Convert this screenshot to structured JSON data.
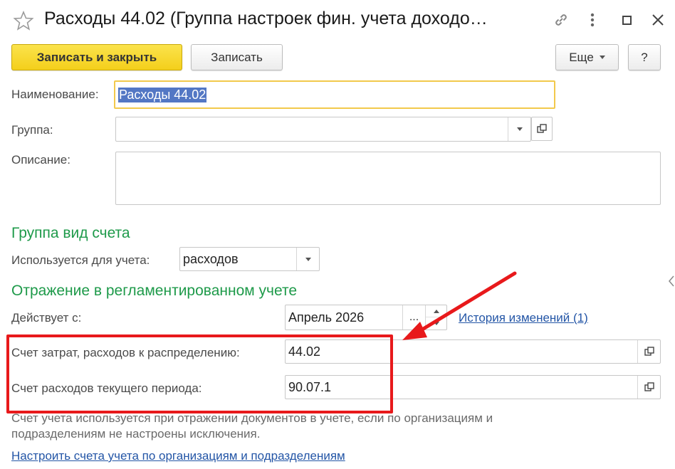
{
  "window": {
    "title": "Расходы 44.02 (Группа настроек фин. учета доходо…",
    "icons": [
      "star-icon",
      "link-icon",
      "more-icon",
      "maximize-icon",
      "close-icon"
    ]
  },
  "toolbar": {
    "save_close_label": "Записать и закрыть",
    "save_label": "Записать",
    "more_label": "Еще",
    "help_label": "?"
  },
  "form": {
    "name_label": "Наименование:",
    "name_value": "Расходы 44.02",
    "group_label": "Группа:",
    "group_value": "",
    "description_label": "Описание:",
    "description_value": ""
  },
  "account_type_section": {
    "title": "Группа вид счета",
    "used_for_label": "Используется для учета:",
    "used_for_value": "расходов"
  },
  "regulated_section": {
    "title": "Отражение в регламентированном учете",
    "effective_label": "Действует с:",
    "effective_value": "Апрель 2026",
    "effective_choose_label": "...",
    "history_link": "История изменений (1)",
    "cost_account_label": "Счет затрат, расходов к распределению:",
    "cost_account_value": "44.02",
    "current_period_label": "Счет расходов текущего периода:",
    "current_period_value": "90.07.1",
    "note": "Счет учета используется при отражении документов в учете, если  по организациям и подразделениям не настроены исключения.",
    "configure_link": "Настроить счета учета по организациям и подразделениям"
  },
  "colors": {
    "accent_green": "#1e9a4a",
    "primary_yellow": "#f4cf1b",
    "link_blue": "#2355a6",
    "annotation_red": "#e8191b",
    "selection_blue": "#5377c4"
  }
}
